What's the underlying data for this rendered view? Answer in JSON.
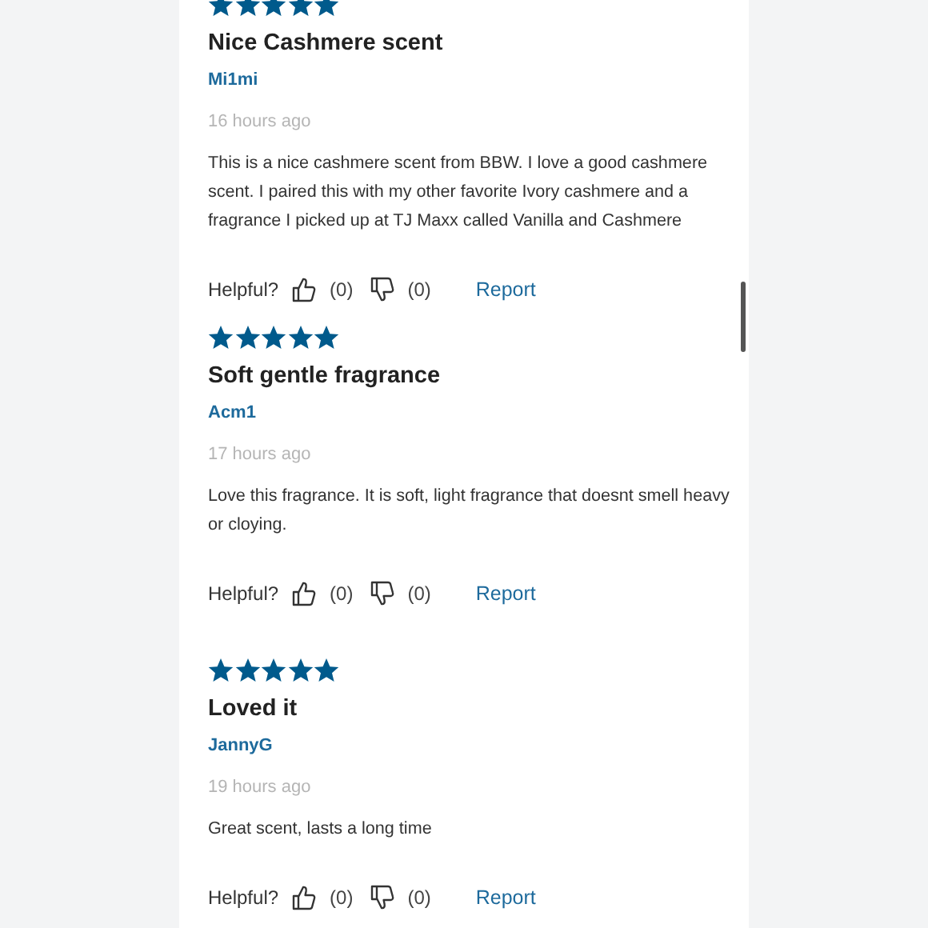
{
  "reviews": [
    {
      "stars": 5,
      "title": "Nice Cashmere scent",
      "author": "Mi1mi",
      "date": "16 hours ago",
      "body": "This is a nice cashmere scent from BBW. I love a good cashmere scent. I paired this with my other favorite Ivory cashmere and a fragrance I picked up at TJ Maxx called Vanilla and Cashmere",
      "helpful_label": "Helpful?",
      "up_count": "(0)",
      "down_count": "(0)",
      "report": "Report"
    },
    {
      "stars": 5,
      "title": "Soft gentle fragrance",
      "author": "Acm1",
      "date": "17 hours ago",
      "body": "Love this fragrance. It is soft, light fragrance that doesnt smell heavy or cloying.",
      "helpful_label": "Helpful?",
      "up_count": "(0)",
      "down_count": "(0)",
      "report": "Report"
    },
    {
      "stars": 5,
      "title": "Loved it",
      "author": "JannyG",
      "date": "19 hours ago",
      "body": "Great scent, lasts a long time",
      "helpful_label": "Helpful?",
      "up_count": "(0)",
      "down_count": "(0)",
      "report": "Report"
    }
  ]
}
